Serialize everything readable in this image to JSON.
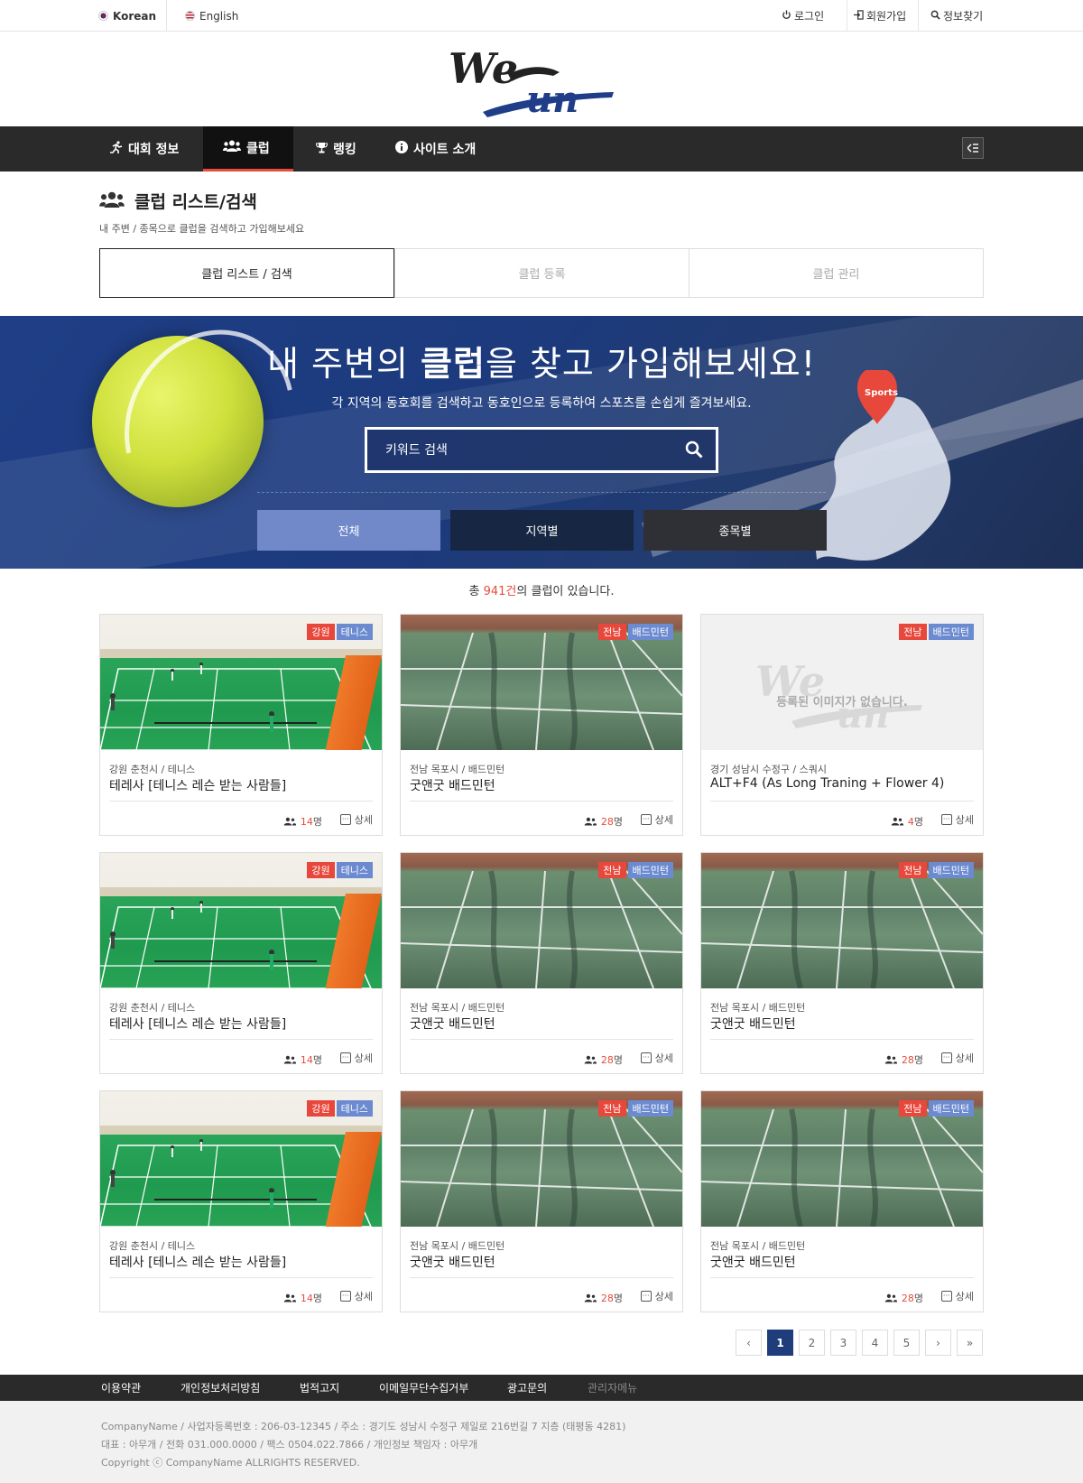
{
  "topbar": {
    "languages": [
      {
        "label": "Korean",
        "flag": "kr-flag-icon"
      },
      {
        "label": "English",
        "flag": "us-flag-icon"
      }
    ],
    "utilities": [
      {
        "label": "로그인",
        "icon": "power-icon"
      },
      {
        "label": "회원가입",
        "icon": "signin-icon"
      },
      {
        "label": "정보찾기",
        "icon": "search-icon"
      }
    ]
  },
  "logo": {
    "text": "WeRun"
  },
  "nav": {
    "items": [
      {
        "label": "대회 정보",
        "icon": "runner-icon"
      },
      {
        "label": "클럽",
        "icon": "users-icon",
        "active": true
      },
      {
        "label": "랭킹",
        "icon": "trophy-icon"
      },
      {
        "label": "사이트 소개",
        "icon": "info-icon"
      }
    ],
    "toggle_icon": "menu-collapse-icon"
  },
  "page": {
    "title": "클럽 리스트/검색",
    "description": "내 주변 / 종목으로 클럽을 검색하고 가입해보세요"
  },
  "subtabs": [
    {
      "label": "클럽 리스트 / 검색",
      "active": true
    },
    {
      "label": "클럽 등록",
      "active": false
    },
    {
      "label": "클럽 관리",
      "active": false
    }
  ],
  "hero": {
    "title_pre": "내 주변의 ",
    "title_bold": "클럽",
    "title_post": "을 찾고 가입해보세요!",
    "subtitle": "각 지역의 동호회를 검색하고 동호인으로 등록하여 스포츠를 손쉽게 즐겨보세요.",
    "search_placeholder": "키워드 검색",
    "map_pin_label": "Sports",
    "filters": [
      {
        "label": "전체",
        "color": "#7189c9"
      },
      {
        "label": "지역별",
        "color": "#172743"
      },
      {
        "label": "종목별",
        "color": "#2f3036"
      }
    ]
  },
  "count": {
    "pre": "총 ",
    "num": "941건",
    "post": "의 클럽이 있습니다."
  },
  "cards": [
    {
      "region": "강원",
      "sport": "테니스",
      "meta": "강원 춘천시 / 테니스",
      "name": "테레사 [테니스 레슨 받는 사람들]",
      "members": "14",
      "unit": "명",
      "detail": "상세",
      "image": "tennis"
    },
    {
      "region": "전남",
      "sport": "배드민턴",
      "meta": "전남 목포시 / 배드민턴",
      "name": "굿앤굿 배드민턴",
      "members": "28",
      "unit": "명",
      "detail": "상세",
      "image": "pool"
    },
    {
      "region": "전남",
      "sport": "배드민턴",
      "meta": "경기 성남시 수정구 / 스쿼시",
      "name": "ALT+F4 (As Long Traning + Flower 4)",
      "members": "4",
      "unit": "명",
      "detail": "상세",
      "image": "none",
      "no_image_text": "등록된 이미지가 없습니다."
    },
    {
      "region": "강원",
      "sport": "테니스",
      "meta": "강원 춘천시 / 테니스",
      "name": "테레사 [테니스 레슨 받는 사람들]",
      "members": "14",
      "unit": "명",
      "detail": "상세",
      "image": "tennis"
    },
    {
      "region": "전남",
      "sport": "배드민턴",
      "meta": "전남 목포시 / 배드민턴",
      "name": "굿앤굿 배드민턴",
      "members": "28",
      "unit": "명",
      "detail": "상세",
      "image": "pool"
    },
    {
      "region": "전남",
      "sport": "배드민턴",
      "meta": "전남 목포시 / 배드민턴",
      "name": "굿앤굿 배드민턴",
      "members": "28",
      "unit": "명",
      "detail": "상세",
      "image": "pool"
    },
    {
      "region": "강원",
      "sport": "테니스",
      "meta": "강원 춘천시 / 테니스",
      "name": "테레사 [테니스 레슨 받는 사람들]",
      "members": "14",
      "unit": "명",
      "detail": "상세",
      "image": "tennis"
    },
    {
      "region": "전남",
      "sport": "배드민턴",
      "meta": "전남 목포시 / 배드민턴",
      "name": "굿앤굿 배드민턴",
      "members": "28",
      "unit": "명",
      "detail": "상세",
      "image": "pool"
    },
    {
      "region": "전남",
      "sport": "배드민턴",
      "meta": "전남 목포시 / 배드민턴",
      "name": "굿앤굿 배드민턴",
      "members": "28",
      "unit": "명",
      "detail": "상세",
      "image": "pool"
    }
  ],
  "pagination": {
    "prev": "‹",
    "pages": [
      "1",
      "2",
      "3",
      "4",
      "5"
    ],
    "current": "1",
    "next": "›",
    "last": "»"
  },
  "footer_nav": [
    {
      "label": "이용약관"
    },
    {
      "label": "개인정보처리방침"
    },
    {
      "label": "법적고지"
    },
    {
      "label": "이메일무단수집거부"
    },
    {
      "label": "광고문의"
    },
    {
      "label": "관리자메뉴"
    }
  ],
  "footer": {
    "line1": "CompanyName / 사업자등록번호 : 206-03-12345 / 주소 : 경기도 성남시 수정구 제일로 216번길 7 지층 (태평동 4281)",
    "line2": "대표 : 아무개 / 전화 031.000.0000 / 팩스 0504.022.7866 / 개인정보 책임자 : 아무개",
    "line3": "Copyright ⓒ CompanyName ALLRIGHTS RESERVED."
  }
}
